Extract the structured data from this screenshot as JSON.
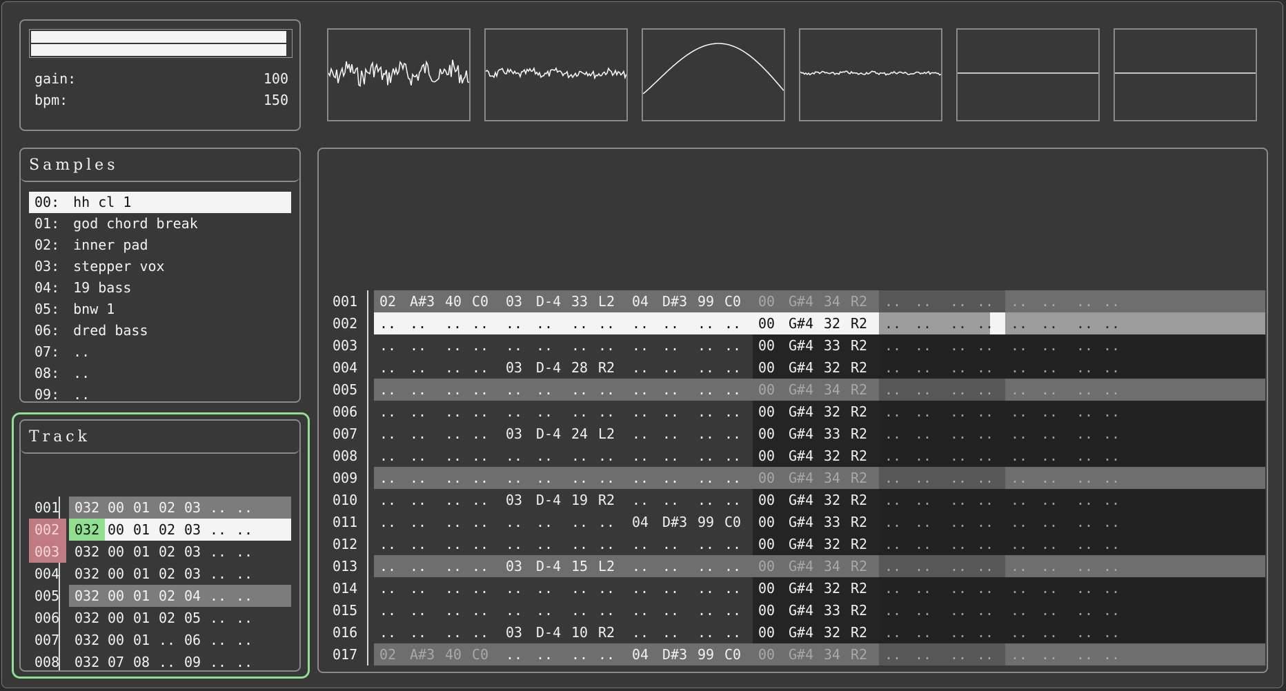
{
  "master": {
    "meters": [
      0.99,
      0.99
    ],
    "gain_label": "gain:",
    "gain_value": "100",
    "bpm_label": "bpm:",
    "bpm_value": "150"
  },
  "scopes": [
    {
      "wave": "noise-loud"
    },
    {
      "wave": "noise-medium"
    },
    {
      "wave": "sine-rise"
    },
    {
      "wave": "noise-quiet"
    },
    {
      "wave": "flat"
    },
    {
      "wave": "flat"
    }
  ],
  "samples": {
    "title": "Samples",
    "items": [
      {
        "idx": "00:",
        "name": "hh cl 1",
        "selected": true
      },
      {
        "idx": "01:",
        "name": "god chord break"
      },
      {
        "idx": "02:",
        "name": "inner pad"
      },
      {
        "idx": "03:",
        "name": "stepper vox"
      },
      {
        "idx": "04:",
        "name": "19 bass"
      },
      {
        "idx": "05:",
        "name": "bnw 1"
      },
      {
        "idx": "06:",
        "name": "dred bass"
      },
      {
        "idx": "07:",
        "name": ".."
      },
      {
        "idx": "08:",
        "name": ".."
      },
      {
        "idx": "09:",
        "name": ".."
      }
    ]
  },
  "track": {
    "title": "Track",
    "rows": [
      {
        "num": "001",
        "cells": [
          "032",
          "00",
          "01",
          "02",
          "03",
          "..",
          ".."
        ],
        "style": "hl"
      },
      {
        "num": "002",
        "cells": [
          "032",
          "00",
          "01",
          "02",
          "03",
          "..",
          ".."
        ],
        "style": "sel",
        "mark": true,
        "cursor": 0
      },
      {
        "num": "003",
        "cells": [
          "032",
          "00",
          "01",
          "02",
          "03",
          "..",
          ".."
        ],
        "mark": true
      },
      {
        "num": "004",
        "cells": [
          "032",
          "00",
          "01",
          "02",
          "03",
          "..",
          ".."
        ]
      },
      {
        "num": "005",
        "cells": [
          "032",
          "00",
          "01",
          "02",
          "04",
          "..",
          ".."
        ],
        "style": "hl"
      },
      {
        "num": "006",
        "cells": [
          "032",
          "00",
          "01",
          "02",
          "05",
          "..",
          ".."
        ]
      },
      {
        "num": "007",
        "cells": [
          "032",
          "00",
          "01",
          "..",
          "06",
          "..",
          ".."
        ]
      },
      {
        "num": "008",
        "cells": [
          "032",
          "07",
          "08",
          "..",
          "09",
          "..",
          ".."
        ]
      }
    ]
  },
  "pattern": {
    "rows": [
      {
        "num": "001",
        "tracks": [
          [
            "02",
            "A#3",
            "40",
            "C0"
          ],
          [
            "03",
            "D-4",
            "33",
            "L2"
          ],
          [
            "04",
            "D#3",
            "99",
            "C0"
          ],
          [
            "00",
            "G#4",
            "34",
            "R2"
          ],
          [
            "..",
            "..",
            "..",
            ".."
          ],
          [
            "..",
            "..",
            "..",
            ".."
          ]
        ]
      },
      {
        "num": "002",
        "tracks": [
          [
            "..",
            "..",
            "..",
            ".."
          ],
          [
            "..",
            "..",
            "..",
            ".."
          ],
          [
            "..",
            "..",
            "..",
            ".."
          ],
          [
            "00",
            "G#4",
            "32",
            "R2"
          ],
          [
            "..",
            "..",
            "..",
            ".."
          ],
          [
            "..",
            "..",
            "..",
            ".."
          ]
        ]
      },
      {
        "num": "003",
        "tracks": [
          [
            "..",
            "..",
            "..",
            ".."
          ],
          [
            "..",
            "..",
            "..",
            ".."
          ],
          [
            "..",
            "..",
            "..",
            ".."
          ],
          [
            "00",
            "G#4",
            "33",
            "R2"
          ],
          [
            "..",
            "..",
            "..",
            ".."
          ],
          [
            "..",
            "..",
            "..",
            ".."
          ]
        ]
      },
      {
        "num": "004",
        "tracks": [
          [
            "..",
            "..",
            "..",
            ".."
          ],
          [
            "03",
            "D-4",
            "28",
            "R2"
          ],
          [
            "..",
            "..",
            "..",
            ".."
          ],
          [
            "00",
            "G#4",
            "32",
            "R2"
          ],
          [
            "..",
            "..",
            "..",
            ".."
          ],
          [
            "..",
            "..",
            "..",
            ".."
          ]
        ]
      },
      {
        "num": "005",
        "tracks": [
          [
            "..",
            "..",
            "..",
            ".."
          ],
          [
            "..",
            "..",
            "..",
            ".."
          ],
          [
            "..",
            "..",
            "..",
            ".."
          ],
          [
            "00",
            "G#4",
            "34",
            "R2"
          ],
          [
            "..",
            "..",
            "..",
            ".."
          ],
          [
            "..",
            "..",
            "..",
            ".."
          ]
        ]
      },
      {
        "num": "006",
        "tracks": [
          [
            "..",
            "..",
            "..",
            ".."
          ],
          [
            "..",
            "..",
            "..",
            ".."
          ],
          [
            "..",
            "..",
            "..",
            ".."
          ],
          [
            "00",
            "G#4",
            "32",
            "R2"
          ],
          [
            "..",
            "..",
            "..",
            ".."
          ],
          [
            "..",
            "..",
            "..",
            ".."
          ]
        ]
      },
      {
        "num": "007",
        "tracks": [
          [
            "..",
            "..",
            "..",
            ".."
          ],
          [
            "03",
            "D-4",
            "24",
            "L2"
          ],
          [
            "..",
            "..",
            "..",
            ".."
          ],
          [
            "00",
            "G#4",
            "33",
            "R2"
          ],
          [
            "..",
            "..",
            "..",
            ".."
          ],
          [
            "..",
            "..",
            "..",
            ".."
          ]
        ]
      },
      {
        "num": "008",
        "tracks": [
          [
            "..",
            "..",
            "..",
            ".."
          ],
          [
            "..",
            "..",
            "..",
            ".."
          ],
          [
            "..",
            "..",
            "..",
            ".."
          ],
          [
            "00",
            "G#4",
            "32",
            "R2"
          ],
          [
            "..",
            "..",
            "..",
            ".."
          ],
          [
            "..",
            "..",
            "..",
            ".."
          ]
        ]
      },
      {
        "num": "009",
        "tracks": [
          [
            "..",
            "..",
            "..",
            ".."
          ],
          [
            "..",
            "..",
            "..",
            ".."
          ],
          [
            "..",
            "..",
            "..",
            ".."
          ],
          [
            "00",
            "G#4",
            "34",
            "R2"
          ],
          [
            "..",
            "..",
            "..",
            ".."
          ],
          [
            "..",
            "..",
            "..",
            ".."
          ]
        ]
      },
      {
        "num": "010",
        "tracks": [
          [
            "..",
            "..",
            "..",
            ".."
          ],
          [
            "03",
            "D-4",
            "19",
            "R2"
          ],
          [
            "..",
            "..",
            "..",
            ".."
          ],
          [
            "00",
            "G#4",
            "32",
            "R2"
          ],
          [
            "..",
            "..",
            "..",
            ".."
          ],
          [
            "..",
            "..",
            "..",
            ".."
          ]
        ]
      },
      {
        "num": "011",
        "tracks": [
          [
            "..",
            "..",
            "..",
            ".."
          ],
          [
            "..",
            "..",
            "..",
            ".."
          ],
          [
            "04",
            "D#3",
            "99",
            "C0"
          ],
          [
            "00",
            "G#4",
            "33",
            "R2"
          ],
          [
            "..",
            "..",
            "..",
            ".."
          ],
          [
            "..",
            "..",
            "..",
            ".."
          ]
        ]
      },
      {
        "num": "012",
        "tracks": [
          [
            "..",
            "..",
            "..",
            ".."
          ],
          [
            "..",
            "..",
            "..",
            ".."
          ],
          [
            "..",
            "..",
            "..",
            ".."
          ],
          [
            "00",
            "G#4",
            "32",
            "R2"
          ],
          [
            "..",
            "..",
            "..",
            ".."
          ],
          [
            "..",
            "..",
            "..",
            ".."
          ]
        ]
      },
      {
        "num": "013",
        "tracks": [
          [
            "..",
            "..",
            "..",
            ".."
          ],
          [
            "03",
            "D-4",
            "15",
            "L2"
          ],
          [
            "..",
            "..",
            "..",
            ".."
          ],
          [
            "00",
            "G#4",
            "34",
            "R2"
          ],
          [
            "..",
            "..",
            "..",
            ".."
          ],
          [
            "..",
            "..",
            "..",
            ".."
          ]
        ]
      },
      {
        "num": "014",
        "tracks": [
          [
            "..",
            "..",
            "..",
            ".."
          ],
          [
            "..",
            "..",
            "..",
            ".."
          ],
          [
            "..",
            "..",
            "..",
            ".."
          ],
          [
            "00",
            "G#4",
            "32",
            "R2"
          ],
          [
            "..",
            "..",
            "..",
            ".."
          ],
          [
            "..",
            "..",
            "..",
            ".."
          ]
        ]
      },
      {
        "num": "015",
        "tracks": [
          [
            "..",
            "..",
            "..",
            ".."
          ],
          [
            "..",
            "..",
            "..",
            ".."
          ],
          [
            "..",
            "..",
            "..",
            ".."
          ],
          [
            "00",
            "G#4",
            "33",
            "R2"
          ],
          [
            "..",
            "..",
            "..",
            ".."
          ],
          [
            "..",
            "..",
            "..",
            ".."
          ]
        ]
      },
      {
        "num": "016",
        "tracks": [
          [
            "..",
            "..",
            "..",
            ".."
          ],
          [
            "03",
            "D-4",
            "10",
            "R2"
          ],
          [
            "..",
            "..",
            "..",
            ".."
          ],
          [
            "00",
            "G#4",
            "32",
            "R2"
          ],
          [
            "..",
            "..",
            "..",
            ".."
          ],
          [
            "..",
            "..",
            "..",
            ".."
          ]
        ]
      },
      {
        "num": "017",
        "tracks": [
          [
            "02",
            "A#3",
            "40",
            "C0"
          ],
          [
            "..",
            "..",
            "..",
            ".."
          ],
          [
            "04",
            "D#3",
            "99",
            "C0"
          ],
          [
            "00",
            "G#4",
            "34",
            "R2"
          ],
          [
            "..",
            "..",
            "..",
            ".."
          ],
          [
            "..",
            "..",
            "..",
            ".."
          ]
        ]
      }
    ]
  }
}
